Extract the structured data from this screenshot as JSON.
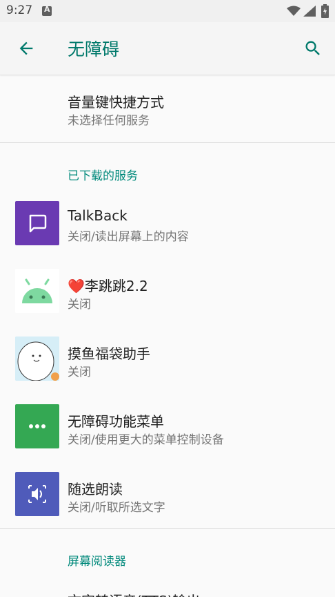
{
  "status_bar": {
    "time": "9:27"
  },
  "app_bar": {
    "title": "无障碍"
  },
  "items": {
    "volume_shortcut": {
      "title": "音量键快捷方式",
      "subtitle": "未选择任何服务"
    },
    "section_downloaded": "已下载的服务",
    "talkback": {
      "title": "TalkBack",
      "subtitle": "关闭/读出屏幕上的内容",
      "color": "#6a3ab2"
    },
    "lititiao": {
      "title": "❤️李跳跳2.2",
      "subtitle": "关闭"
    },
    "moyu": {
      "title": "摸鱼福袋助手",
      "subtitle": "关闭"
    },
    "a11y_menu": {
      "title": "无障碍功能菜单",
      "subtitle": "关闭/使用更大的菜单控制设备",
      "color": "#34a853"
    },
    "select_to_speak": {
      "title": "随选朗读",
      "subtitle": "关闭/听取所选文字",
      "color": "#4f5bba"
    },
    "section_screen_reader": "屏幕阅读器",
    "tts_partial": {
      "title": "文字转语音(TTS)输出"
    }
  },
  "icons": {
    "back": "arrow-back-icon",
    "search": "search-icon",
    "talkback": "chat-bubble-icon",
    "lititiao": "android-head-icon",
    "moyu": "cartoon-avatar-icon",
    "a11y_menu": "more-horizontal-icon",
    "select_to_speak": "speaker-icon"
  },
  "colors": {
    "accent": "#00796b",
    "section": "#00897b"
  }
}
